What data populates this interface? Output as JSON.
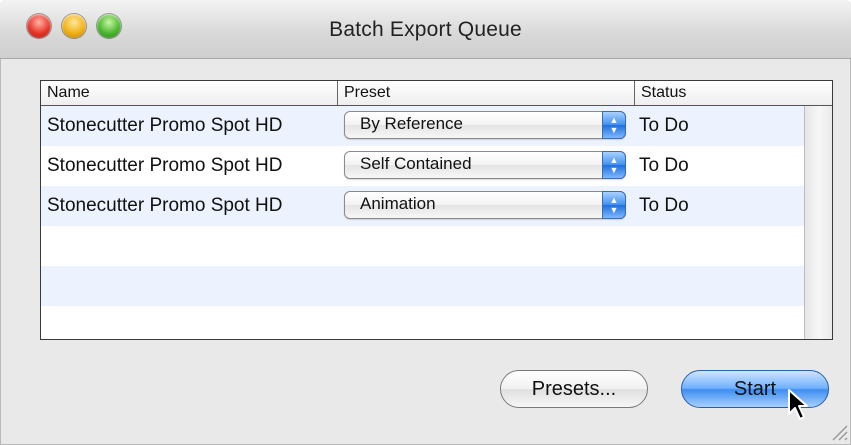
{
  "window": {
    "title": "Batch Export Queue"
  },
  "table": {
    "headers": {
      "name": "Name",
      "preset": "Preset",
      "status": "Status"
    },
    "rows": [
      {
        "name": "Stonecutter Promo Spot HD",
        "preset": "By Reference",
        "status": "To Do"
      },
      {
        "name": "Stonecutter Promo Spot HD",
        "preset": "Self Contained",
        "status": "To Do"
      },
      {
        "name": "Stonecutter Promo Spot HD",
        "preset": "Animation",
        "status": "To Do"
      }
    ]
  },
  "buttons": {
    "presets": "Presets...",
    "start": "Start"
  },
  "icons": {
    "close": "close-button",
    "minimize": "minimize-button",
    "zoom": "zoom-button",
    "popup_arrows": "up-down-arrows-icon",
    "cursor": "arrow-cursor-icon",
    "resize": "resize-grip-icon"
  },
  "colors": {
    "accent": "#3d8df0",
    "alt_row": "#edf3fe"
  }
}
